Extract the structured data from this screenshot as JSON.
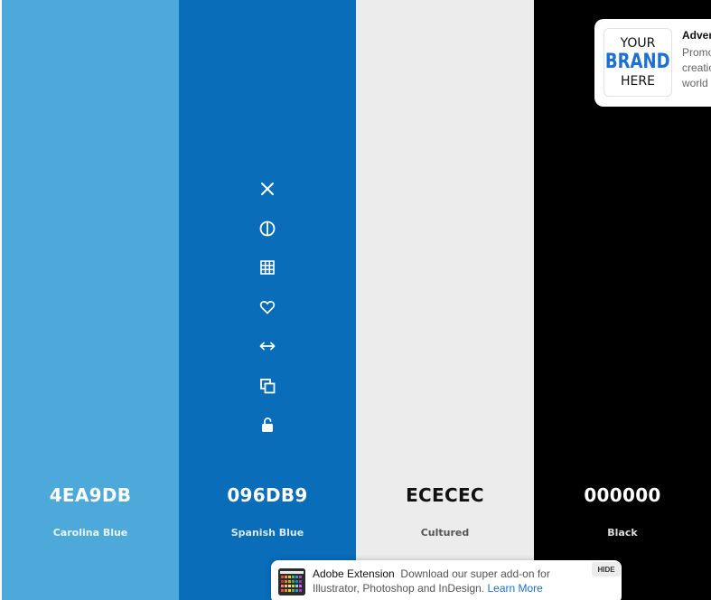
{
  "colors": [
    {
      "hex": "4EA9DB",
      "name": "Carolina Blue",
      "bg": "#4EA9DB",
      "fg": "#ffffff",
      "name_fg": "#e8f3fa"
    },
    {
      "hex": "096DB9",
      "name": "Spanish Blue",
      "bg": "#096DB9",
      "fg": "#ffffff",
      "name_fg": "#dbe8f3"
    },
    {
      "hex": "ECECEC",
      "name": "Cultured",
      "bg": "#ECECEC",
      "fg": "#111111",
      "name_fg": "#555555"
    },
    {
      "hex": "000000",
      "name": "Black",
      "bg": "#000000",
      "fg": "#ffffff",
      "name_fg": "#dddddd"
    }
  ],
  "tools": [
    "close-icon",
    "contrast-icon",
    "grid-icon",
    "heart-icon",
    "arrows-horizontal-icon",
    "copy-icon",
    "unlock-icon"
  ],
  "ad": {
    "logo_line1": "YOUR",
    "logo_line2": "BRAND",
    "logo_line3": "HERE",
    "title": "Adver",
    "text_lines": [
      "Promo",
      "creatio",
      "world"
    ]
  },
  "banner": {
    "title": "Adobe Extension",
    "text": "Download our super add-on for Illustrator, Photoshop and InDesign.",
    "link": "Learn More",
    "hide_label": "HIDE"
  }
}
